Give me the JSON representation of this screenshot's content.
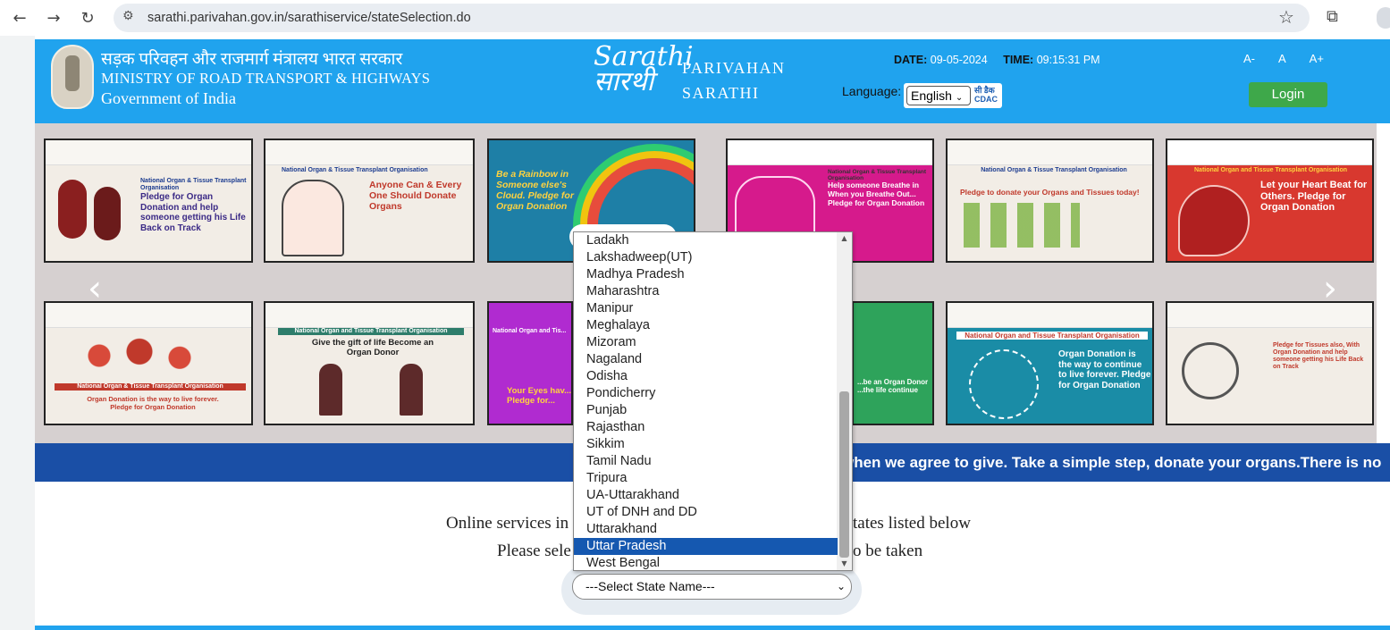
{
  "browser": {
    "url": "sarathi.parivahan.gov.in/sarathiservice/stateSelection.do",
    "back_icon": "←",
    "forward_icon": "→",
    "reload_icon": "↻",
    "site_info_icon": "⚙",
    "star_icon": "☆",
    "extensions_icon": "⧉"
  },
  "header": {
    "ministry_hindi": "सड़क परिवहन और राजमार्ग मंत्रालय भारत सरकार",
    "ministry_english": "MINISTRY OF ROAD TRANSPORT & HIGHWAYS",
    "government": "Government of India",
    "logo_line1": "Sarathi",
    "logo_line2": "सारथी",
    "logo_title1": "PARIVAHAN",
    "logo_title2": "SARATHI",
    "date_label": "DATE:",
    "date_value": "09-05-2024",
    "time_label": "TIME:",
    "time_value": "09:15:31 PM",
    "font_smaller": "A-",
    "font_normal": "A",
    "font_larger": "A+",
    "language_label": "Language:",
    "language_value": "English",
    "cdac_line1": "सी डैक",
    "cdac_line2": "CDAC",
    "login": "Login",
    "brand_color": "#20a3ee"
  },
  "carousel": {
    "prev_icon": "‹",
    "next_icon": "›",
    "posters_top": [
      {
        "org": "National Organ & Tissue Transplant Organisation",
        "text": "Pledge for Organ Donation and help someone getting his Life Back on Track"
      },
      {
        "org": "National Organ & Tissue Transplant Organisation",
        "text": "Anyone Can & Every One Should Donate Organs"
      },
      {
        "org": "",
        "text": "Be a Rainbow in Someone else's Cloud. Pledge for Organ Donation"
      },
      {
        "org": "National Organ & Tissue Transplant Organisation",
        "text": "Help someone Breathe in When you Breathe Out... Pledge for Organ Donation"
      },
      {
        "org": "National Organ & Tissue Transplant Organisation",
        "text": "Pledge to donate your Organs and Tissues today!"
      },
      {
        "org": "National Organ and Tissue Transplant Organisation",
        "text": "Let your Heart Beat for Others. Pledge for Organ Donation"
      }
    ],
    "posters_bottom": [
      {
        "org": "National Organ and Tissue Transplant Organisation",
        "text": "Organ Donation is the way to live forever. Pledge for Organ Donation"
      },
      {
        "org": "National Organ and Tissue Transplant Organisation",
        "text": "Give the gift of life Become an Organ Donor"
      },
      {
        "org": "National Organ and Tis...",
        "text": "Your Eyes hav... Pledge for..."
      },
      {
        "org": "",
        "text": "...be an Organ Donor ...the life continue"
      },
      {
        "org": "National Organ and Tissue Transplant Organisation",
        "text": "Organ Donation is the way to continue to live forever. Pledge for Organ Donation"
      },
      {
        "org": "",
        "text": "Pledge for Tissues also, With Organ Donation and help someone getting his Life Back on Track"
      }
    ]
  },
  "marquee": {
    "text": "when we agree to give. Take a simple step, donate your organs.There is no"
  },
  "body": {
    "line1_left": "Online services in",
    "line1_right": "tates listed below",
    "line2_left": "Please sele",
    "line2_right": "o be taken"
  },
  "state_select": {
    "placeholder": "---Select State Name---",
    "caret_icon": "⌄",
    "options_visible": [
      "Ladakh",
      "Lakshadweep(UT)",
      "Madhya Pradesh",
      "Maharashtra",
      "Manipur",
      "Meghalaya",
      "Mizoram",
      "Nagaland",
      "Odisha",
      "Pondicherry",
      "Punjab",
      "Rajasthan",
      "Sikkim",
      "Tamil Nadu",
      "Tripura",
      "UA-Uttarakhand",
      "UT of DNH and DD",
      "Uttarakhand",
      "Uttar Pradesh",
      "West Bengal"
    ],
    "highlighted": "Uttar Pradesh",
    "scroll_up_icon": "▲",
    "scroll_down_icon": "▼"
  }
}
